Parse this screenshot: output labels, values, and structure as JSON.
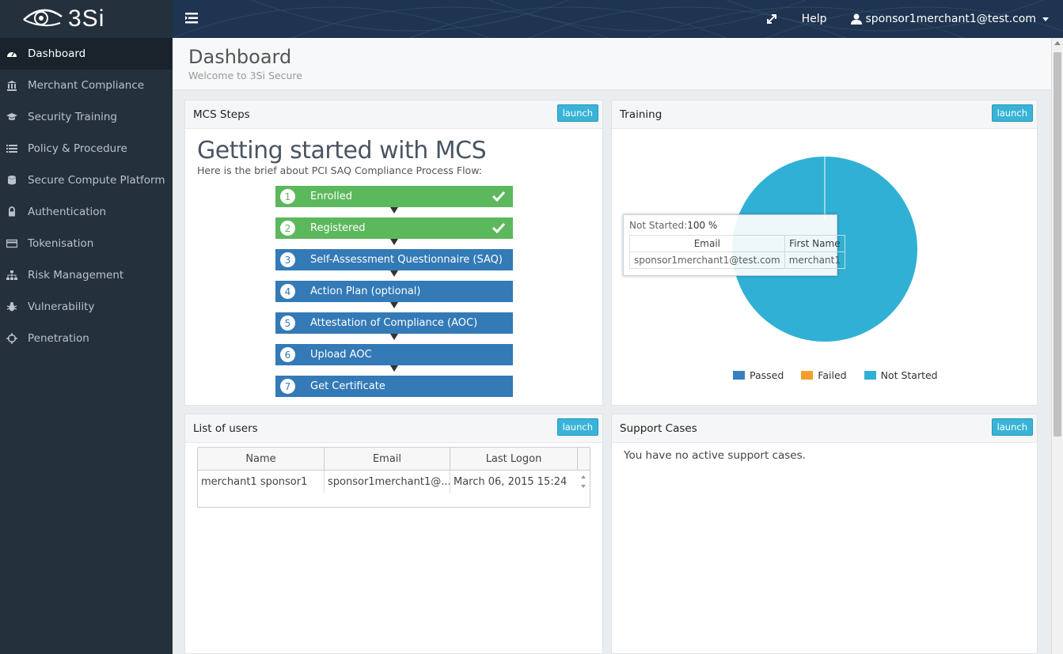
{
  "brand": {
    "name": "3Si"
  },
  "topbar": {
    "help_label": "Help",
    "user_label": "sponsor1merchant1@test.com"
  },
  "sidebar": {
    "items": [
      {
        "label": "Dashboard",
        "icon": "dashboard-icon",
        "active": true
      },
      {
        "label": "Merchant Compliance",
        "icon": "bank-icon"
      },
      {
        "label": "Security Training",
        "icon": "graduation-cap-icon"
      },
      {
        "label": "Policy & Procedure",
        "icon": "list-icon"
      },
      {
        "label": "Secure Compute Platform",
        "icon": "database-icon"
      },
      {
        "label": "Authentication",
        "icon": "lock-icon"
      },
      {
        "label": "Tokenisation",
        "icon": "credit-card-icon"
      },
      {
        "label": "Risk Management",
        "icon": "sitemap-icon"
      },
      {
        "label": "Vulnerability",
        "icon": "bug-icon"
      },
      {
        "label": "Penetration",
        "icon": "crosshairs-icon"
      }
    ]
  },
  "page": {
    "title": "Dashboard",
    "subtitle": "Welcome to 3Si Secure"
  },
  "panels": {
    "launch_label": "launch",
    "mcs": {
      "title": "MCS Steps",
      "heading": "Getting started with MCS",
      "subheading": "Here is the brief about PCI SAQ Compliance Process Flow:",
      "steps": [
        {
          "num": "1",
          "label": "Enrolled",
          "done": true
        },
        {
          "num": "2",
          "label": "Registered",
          "done": true
        },
        {
          "num": "3",
          "label": "Self-Assessment Questionnaire (SAQ)",
          "done": false
        },
        {
          "num": "4",
          "label": "Action Plan (optional)",
          "done": false
        },
        {
          "num": "5",
          "label": "Attestation of Compliance (AOC)",
          "done": false
        },
        {
          "num": "6",
          "label": "Upload AOC",
          "done": false
        },
        {
          "num": "7",
          "label": "Get Certificate",
          "done": false
        }
      ]
    },
    "training": {
      "title": "Training",
      "tooltip": {
        "label": "Not Started:",
        "value": "100 %",
        "col_email": "Email",
        "col_first": "First Name",
        "email": "sponsor1merchant1@test.com",
        "first": "merchant1"
      },
      "legend": [
        {
          "label": "Passed",
          "color": "#3a7fc1"
        },
        {
          "label": "Failed",
          "color": "#f0a02a"
        },
        {
          "label": "Not Started",
          "color": "#31b0d5"
        }
      ]
    },
    "users": {
      "title": "List of users",
      "columns": [
        "Name",
        "Email",
        "Last Logon"
      ],
      "rows": [
        [
          "merchant1 sponsor1",
          "sponsor1merchant1@...",
          "March 06, 2015 15:24"
        ]
      ]
    },
    "support": {
      "title": "Support Cases",
      "message": "You have no active support cases."
    }
  },
  "chart_data": {
    "type": "pie",
    "categories": [
      "Passed",
      "Failed",
      "Not Started"
    ],
    "values": [
      0,
      0,
      100
    ],
    "colors": [
      "#3a7fc1",
      "#f0a02a",
      "#31b0d5"
    ],
    "legend": "bottom"
  }
}
